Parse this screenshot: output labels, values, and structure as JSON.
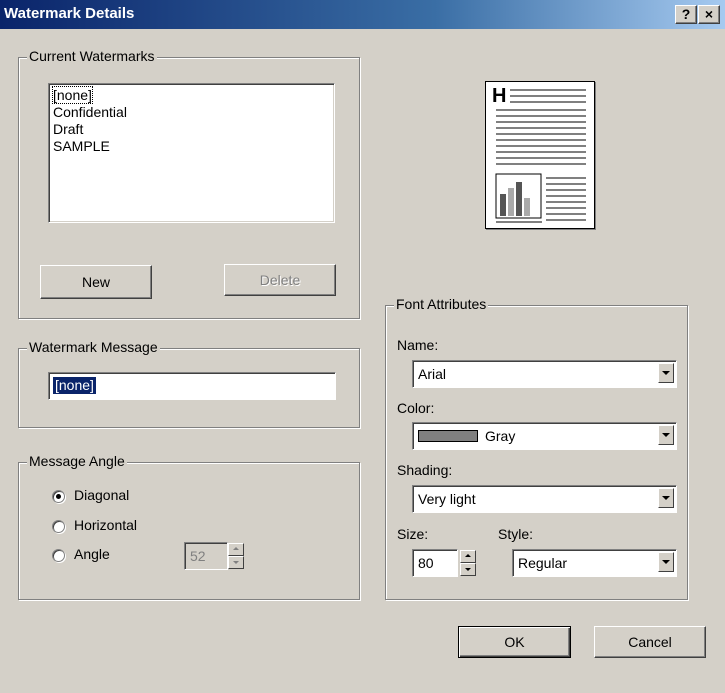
{
  "window": {
    "title": "Watermark Details",
    "help_label": "?",
    "close_label": "×"
  },
  "current_watermarks": {
    "legend": "Current Watermarks",
    "items": [
      "[none]",
      "Confidential",
      "Draft",
      "SAMPLE"
    ],
    "new_label": "New",
    "delete_label": "Delete"
  },
  "watermark_message": {
    "legend": "Watermark Message",
    "value": "[none]"
  },
  "message_angle": {
    "legend": "Message Angle",
    "options": [
      {
        "label": "Diagonal",
        "checked": true
      },
      {
        "label": "Horizontal",
        "checked": false
      },
      {
        "label": "Angle",
        "checked": false
      }
    ],
    "angle_value": "52"
  },
  "font_attributes": {
    "legend": "Font Attributes",
    "name_label": "Name:",
    "name_value": "Arial",
    "color_label": "Color:",
    "color_value": "Gray",
    "color_swatch": "#808080",
    "shading_label": "Shading:",
    "shading_value": "Very light",
    "size_label": "Size:",
    "size_value": "80",
    "style_label": "Style:",
    "style_value": "Regular"
  },
  "buttons": {
    "ok_label": "OK",
    "cancel_label": "Cancel"
  },
  "preview": {
    "icon": "document-preview-icon",
    "header_letter": "H"
  }
}
